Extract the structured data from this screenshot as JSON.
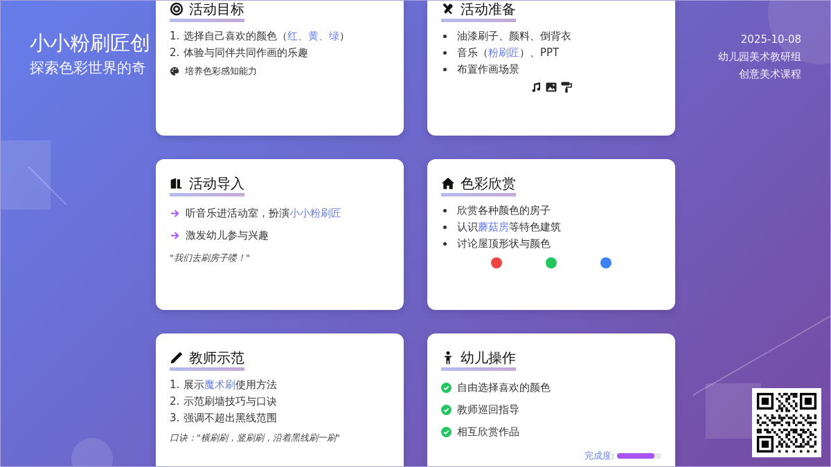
{
  "header": {
    "title": "小小粉刷匠创",
    "subtitle": "探索色彩世界的奇"
  },
  "meta": {
    "date": "2025-10-08",
    "group": "幼儿园美术教研组",
    "course": "创意美术课程"
  },
  "cards": [
    {
      "title": "活动目标",
      "kind": "ordered",
      "items": [
        {
          "number": "1.",
          "segments": [
            {
              "text": "选择自己喜欢的颜色（",
              "highlight": false
            },
            {
              "text": "红、黄、绿",
              "highlight": true
            },
            {
              "text": "）",
              "highlight": false
            }
          ]
        },
        {
          "number": "2.",
          "segments": [
            {
              "text": "体验与同伴共同作画的乐趣",
              "highlight": false
            }
          ]
        }
      ],
      "note": "培养色彩感知能力"
    },
    {
      "title": "活动准备",
      "kind": "bullet",
      "items": [
        {
          "segments": [
            {
              "text": "油漆刷子、颜料、倒背衣",
              "highlight": false
            }
          ]
        },
        {
          "segments": [
            {
              "text": "音乐（",
              "highlight": false
            },
            {
              "text": "粉刷匠",
              "highlight": true
            },
            {
              "text": "）、PPT",
              "highlight": false
            }
          ]
        },
        {
          "segments": [
            {
              "text": "布置作画场景",
              "highlight": false
            }
          ]
        }
      ]
    },
    {
      "title": "活动导入",
      "kind": "arrow",
      "items": [
        {
          "segments": [
            {
              "text": "听音乐进活动室，扮演",
              "highlight": false
            },
            {
              "text": "小小粉刷匠",
              "highlight": true
            }
          ]
        },
        {
          "segments": [
            {
              "text": "激发幼儿参与兴趣",
              "highlight": false
            }
          ]
        }
      ],
      "quote": "\"我们去刷房子喽！\""
    },
    {
      "title": "色彩欣赏",
      "kind": "bullet",
      "items": [
        {
          "segments": [
            {
              "text": "欣赏各种颜色的房子",
              "highlight": false
            }
          ]
        },
        {
          "segments": [
            {
              "text": "认识",
              "highlight": false
            },
            {
              "text": "蘑菇房",
              "highlight": true
            },
            {
              "text": "等特色建筑",
              "highlight": false
            }
          ]
        },
        {
          "segments": [
            {
              "text": "讨论屋顶形状与颜色",
              "highlight": false
            }
          ]
        }
      ],
      "dots": [
        {
          "color": "#ef4444"
        },
        {
          "color": "#22c55e"
        },
        {
          "color": "#3b82f6"
        }
      ]
    },
    {
      "title": "教师示范",
      "kind": "ordered",
      "items": [
        {
          "number": "1.",
          "segments": [
            {
              "text": "展示",
              "highlight": false
            },
            {
              "text": "魔术刷",
              "highlight": true
            },
            {
              "text": "使用方法",
              "highlight": false
            }
          ]
        },
        {
          "number": "2.",
          "segments": [
            {
              "text": "示范刷墙技巧与口诀",
              "highlight": false
            }
          ]
        },
        {
          "number": "3.",
          "segments": [
            {
              "text": "强调不超出黑线范围",
              "highlight": false
            }
          ]
        }
      ],
      "quote": "口诀：\"横刷刷，竖刷刷，沿着黑线刷一刷\""
    },
    {
      "title": "幼儿操作",
      "kind": "check",
      "items": [
        {
          "segments": [
            {
              "text": "自由选择喜欢的颜色",
              "highlight": false
            }
          ]
        },
        {
          "segments": [
            {
              "text": "教师巡回指导",
              "highlight": false
            }
          ]
        },
        {
          "segments": [
            {
              "text": "相互欣赏作品",
              "highlight": false
            }
          ]
        }
      ],
      "progress": {
        "label": "完成度:",
        "level": 0.85
      }
    }
  ]
}
